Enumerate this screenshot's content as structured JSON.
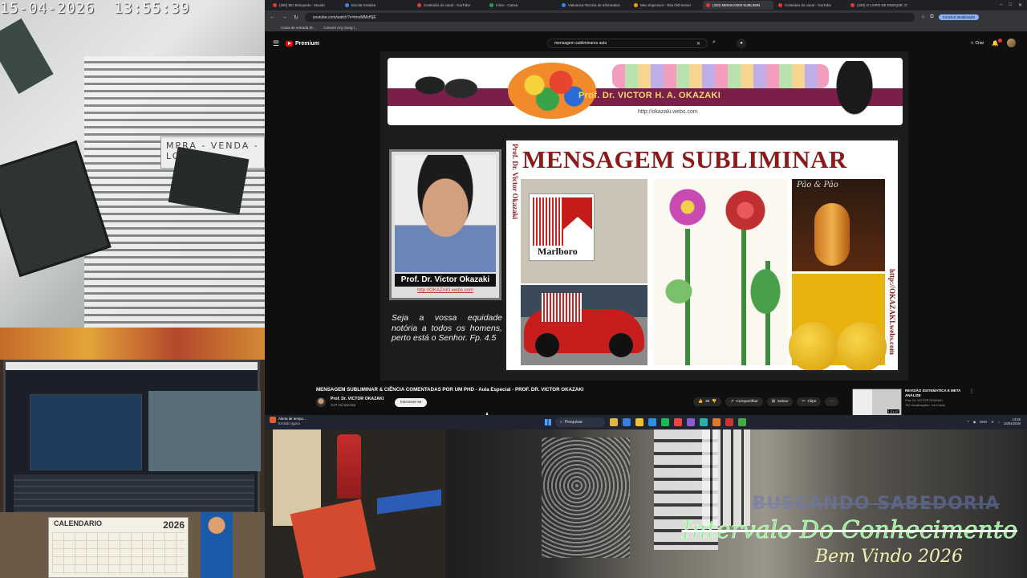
{
  "overlay": {
    "timestamp": "15-04-2026  13:55:39",
    "strike_text": "BUSCANDO SABEDORIA",
    "main_text": "Intervalo Do Conhecimento",
    "welcome": "Bem Vindo 2026"
  },
  "camera": {
    "sign_text": "MPRA - VENDA - LOT",
    "calendar_title": "CALENDARIO",
    "calendar_year": "2026"
  },
  "browser": {
    "tabs": [
      {
        "label": "(300) MC Brinquedo - Mundo",
        "icon": "youtube-icon",
        "active": false
      },
      {
        "label": "Escola Gratuita",
        "icon": "page-icon",
        "active": false
      },
      {
        "label": "Conteúdo do canal - YouTube",
        "icon": "youtube-icon",
        "active": false
      },
      {
        "label": "Início - Canva",
        "icon": "canva-icon",
        "active": false
      },
      {
        "label": "Videoteca Tecnica de Informatica",
        "icon": "page-icon",
        "active": false
      },
      {
        "label": "Meu Impressor - Rita Old Server",
        "icon": "page-icon",
        "active": false
      },
      {
        "label": "(420) MENSAGEM SUBLIMIN",
        "icon": "youtube-icon",
        "active": true
      },
      {
        "label": "Conteúdo do canal - YouTube",
        "icon": "youtube-icon",
        "active": false
      },
      {
        "label": "(420) O LIVRO DE ENOQUE: O",
        "icon": "youtube-icon",
        "active": false
      }
    ],
    "url": "youtube.com/watch?v=tmvMMcf0jE",
    "finish_update": "Concluir atualização",
    "bookmarks": [
      "Caixa de entrada (9...",
      "Convert Any Song t..."
    ]
  },
  "youtube": {
    "logo_text": "Premium",
    "search_value": "mensagem subliminares aula",
    "create_label": "Criar",
    "video": {
      "banner_name": "Prof. Dr. VICTOR H. A. OKAZAKI",
      "banner_url": "http://okazaki.webs.com",
      "poster_title": "MENSAGEM SUBLIMINAR",
      "poster_side_left": "Prof. Dr. Victor Okazaki",
      "poster_side_right": "http://OKAZAKI.webs.com",
      "pack_brand": "Marlboro",
      "portrait_caption": "Prof. Dr. Victor Okazaki",
      "portrait_link": "http://OKAZAKI.webs.com",
      "verse": "Seja a vossa equidade notória a todos os homens, perto está o Senhor. Fp. 4.5",
      "bread_text": "Pão & Pão"
    },
    "title": "MENSAGEM SUBLIMINAR & CIÊNCIA COMENTADAS POR UM PHD - Aula Especial - PROF. DR. VICTOR OKAZAKI",
    "channel": "Prof. Dr. VICTOR OKAZAKI",
    "subscribers": "3,07 mil inscritos",
    "subscribe_label": "Inscrever-se",
    "likes": "38",
    "share_label": "Compartilhar",
    "save_label": "Salvar",
    "clip_label": "Clipe",
    "more_label": "···",
    "suggestion": {
      "title": "REVISÃO SISTEMATICA E META ANÁLISE",
      "channel": "Prof. Dr. VICTOR OKAZAKI",
      "views": "782 visualizações · há 4 anos",
      "duration": "1:21:47"
    }
  },
  "taskbar": {
    "alert_title": "Alerta de tempo...",
    "alert_sub": "Emitido agora",
    "search_placeholder": "Pesquisar",
    "lang": "ENG",
    "time": "13:55",
    "date": "15/04/2026"
  }
}
